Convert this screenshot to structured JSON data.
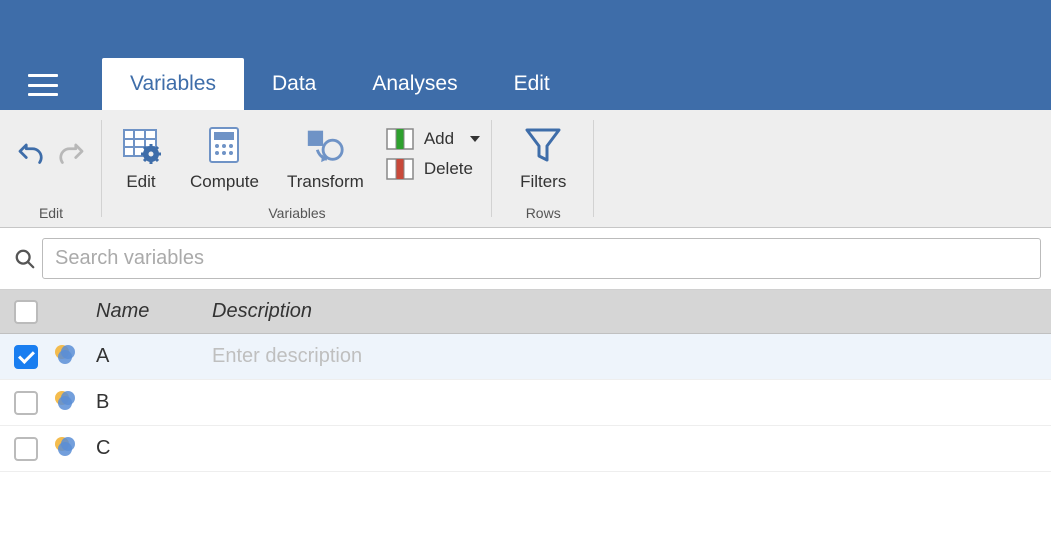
{
  "tabs": {
    "variables": "Variables",
    "data": "Data",
    "analyses": "Analyses",
    "edit": "Edit"
  },
  "ribbon": {
    "edit_group_label": "Edit",
    "variables_group_label": "Variables",
    "rows_group_label": "Rows",
    "edit_btn": "Edit",
    "compute_btn": "Compute",
    "transform_btn": "Transform",
    "add_btn": "Add",
    "delete_btn": "Delete",
    "filters_btn": "Filters"
  },
  "search": {
    "placeholder": "Search variables"
  },
  "table": {
    "headers": {
      "name": "Name",
      "description": "Description"
    },
    "desc_placeholder": "Enter description",
    "rows": [
      {
        "name": "A",
        "description": "",
        "checked": true
      },
      {
        "name": "B",
        "description": "",
        "checked": false
      },
      {
        "name": "C",
        "description": "",
        "checked": false
      }
    ]
  }
}
